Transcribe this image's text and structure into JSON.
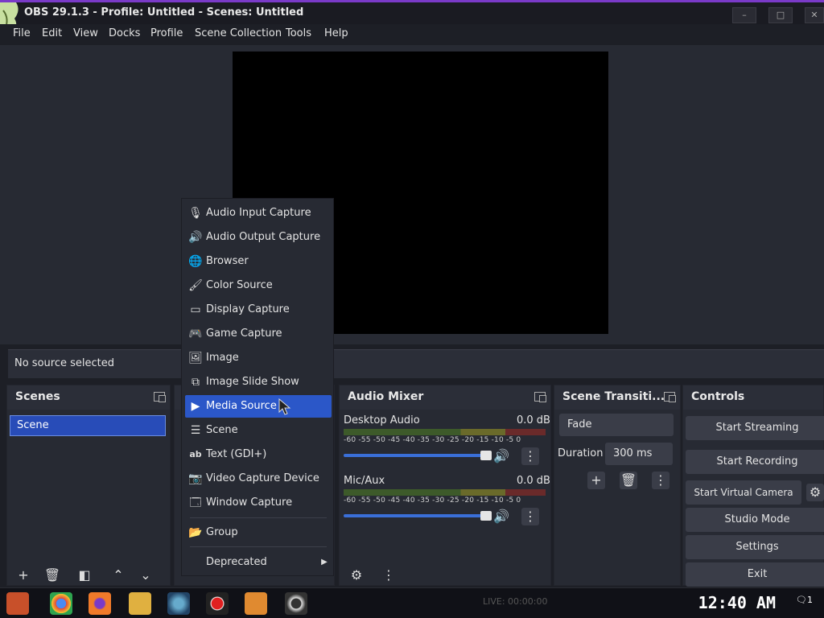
{
  "window": {
    "title": "OBS 29.1.3 - Profile: Untitled - Scenes: Untitled",
    "minimize": "–",
    "maximize": "□",
    "close": "✕"
  },
  "menubar": [
    "File",
    "Edit",
    "View",
    "Docks",
    "Profile",
    "Scene Collection",
    "Tools",
    "Help"
  ],
  "sources": {
    "status": "No source selected"
  },
  "scenes": {
    "title": "Scenes",
    "items": [
      "Scene"
    ]
  },
  "context_menu": {
    "items": [
      {
        "label": "Audio Input Capture",
        "icon": "mic-icon"
      },
      {
        "label": "Audio Output Capture",
        "icon": "speaker-icon"
      },
      {
        "label": "Browser",
        "icon": "globe-icon"
      },
      {
        "label": "Color Source",
        "icon": "brush-icon"
      },
      {
        "label": "Display Capture",
        "icon": "monitor-icon"
      },
      {
        "label": "Game Capture",
        "icon": "gamepad-icon"
      },
      {
        "label": "Image",
        "icon": "image-icon"
      },
      {
        "label": "Image Slide Show",
        "icon": "slideshow-icon"
      },
      {
        "label": "Media Source",
        "icon": "play-icon",
        "highlighted": true
      },
      {
        "label": "Scene",
        "icon": "list-icon"
      },
      {
        "label": "Text (GDI+)",
        "icon": "text-icon"
      },
      {
        "label": "Video Capture Device",
        "icon": "camera-icon"
      },
      {
        "label": "Window Capture",
        "icon": "window-icon"
      }
    ],
    "group": "Group",
    "deprecated": "Deprecated"
  },
  "audio_mixer": {
    "title": "Audio Mixer",
    "channels": [
      {
        "name": "Desktop Audio",
        "level": "0.0 dB"
      },
      {
        "name": "Mic/Aux",
        "level": "0.0 dB"
      }
    ],
    "ticks": "-60 -55 -50 -45 -40 -35 -30 -25 -20 -15 -10 -5 0"
  },
  "transitions": {
    "title": "Scene Transiti...",
    "type": "Fade",
    "duration_label": "Duration",
    "duration": "300 ms"
  },
  "controls": {
    "title": "Controls",
    "start_streaming": "Start Streaming",
    "start_recording": "Start Recording",
    "start_virtual_camera": "Start Virtual Camera",
    "studio_mode": "Studio Mode",
    "settings": "Settings",
    "exit": "Exit"
  },
  "taskbar": {
    "clock": "12:40 AM",
    "live": "LIVE: 00:00:00",
    "notification_count": "1"
  },
  "colors": {
    "accent": "#2b57c8",
    "background": "#272a33",
    "titlebar_accent": "#7a3ac8"
  }
}
